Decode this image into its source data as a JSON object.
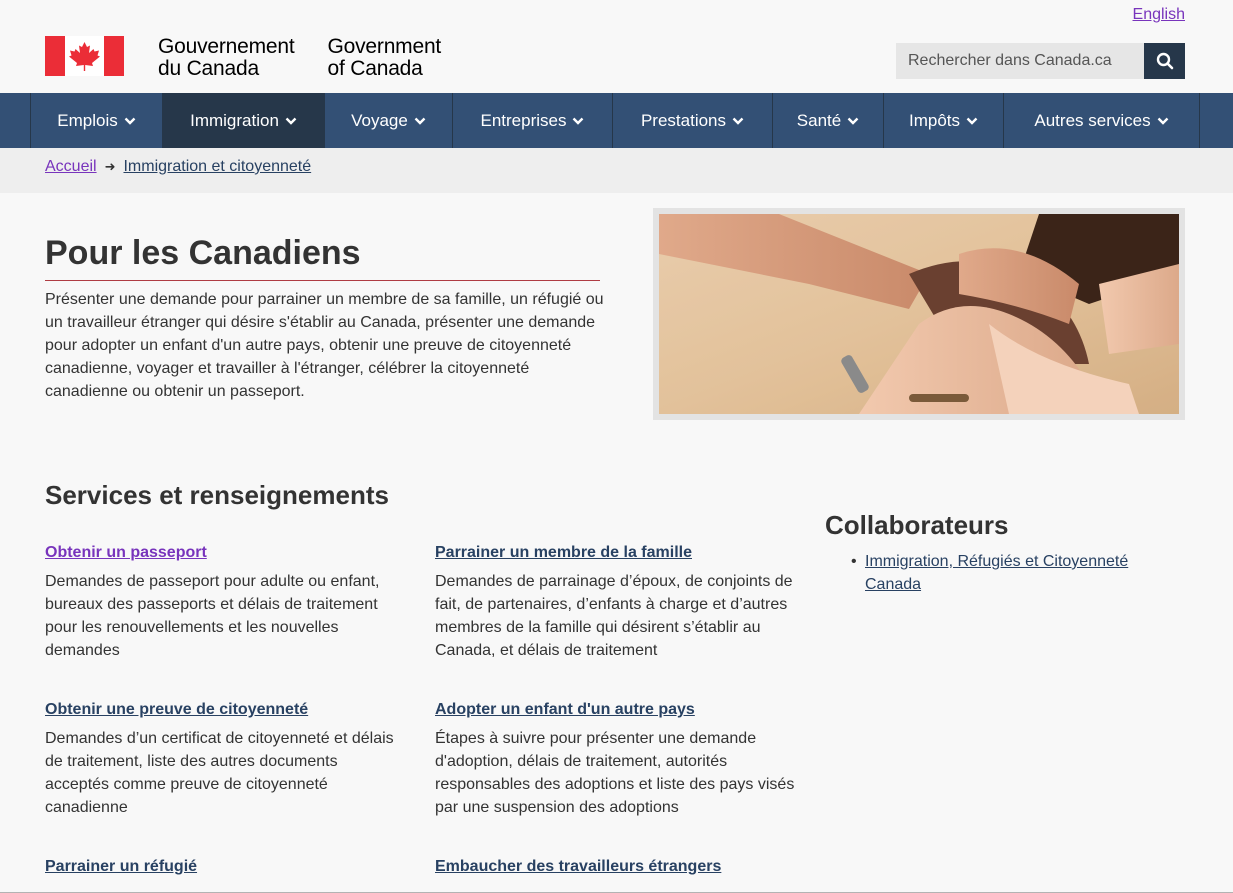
{
  "header": {
    "language_link": "English",
    "brand": {
      "fr_line1": "Gouvernement",
      "fr_line2": "du Canada",
      "en_line1": "Government",
      "en_line2": "of Canada"
    },
    "search": {
      "placeholder": "Rechercher dans Canada.ca"
    }
  },
  "nav": {
    "items": [
      {
        "label": "Emplois"
      },
      {
        "label": "Immigration"
      },
      {
        "label": "Voyage"
      },
      {
        "label": "Entreprises"
      },
      {
        "label": "Prestations"
      },
      {
        "label": "Santé"
      },
      {
        "label": "Impôts"
      },
      {
        "label": "Autres services"
      }
    ],
    "active": "Immigration"
  },
  "breadcrumb": {
    "home": "Accueil",
    "current": "Immigration et citoyenneté"
  },
  "main": {
    "title": "Pour les Canadiens",
    "intro": "Présenter une demande pour parrainer un membre de sa famille, un réfugié ou un travailleur étranger qui désire s'établir au Canada, présenter une demande pour adopter un enfant d'un autre pays, obtenir une preuve de citoyenneté canadienne, voyager et travailler à l'étranger, célébrer la citoyenneté canadienne ou obtenir un passeport.",
    "services_heading": "Services et renseignements",
    "services": [
      {
        "title": "Obtenir un passeport",
        "desc": "Demandes de passeport pour adulte ou enfant, bureaux des passeports et délais de traitement pour les renouvellements et les nouvelles demandes"
      },
      {
        "title": "Parrainer un membre de la famille",
        "desc": "Demandes de parrainage d’époux, de conjoints de fait, de partenaires, d’enfants à charge et d’autres membres de la famille qui désirent s’établir au Canada, et délais de traitement"
      },
      {
        "title": "Obtenir une preuve de citoyenneté",
        "desc": "Demandes d’un certificat de citoyenneté et délais de traitement, liste des autres documents acceptés comme preuve de citoyenneté canadienne"
      },
      {
        "title": "Adopter un enfant d'un autre pays",
        "desc": "Étapes à suivre pour présenter une demande d'adoption, délais de traitement, autorités responsables des adoptions et liste des pays visés par une suspension des adoptions"
      },
      {
        "title": "Parrainer un réfugié",
        "desc": ""
      },
      {
        "title": "Embaucher des travailleurs étrangers",
        "desc": ""
      }
    ],
    "collaborators_heading": "Collaborateurs",
    "collaborators": [
      {
        "label": "Immigration, Réfugiés et Citoyenneté Canada"
      }
    ]
  }
}
